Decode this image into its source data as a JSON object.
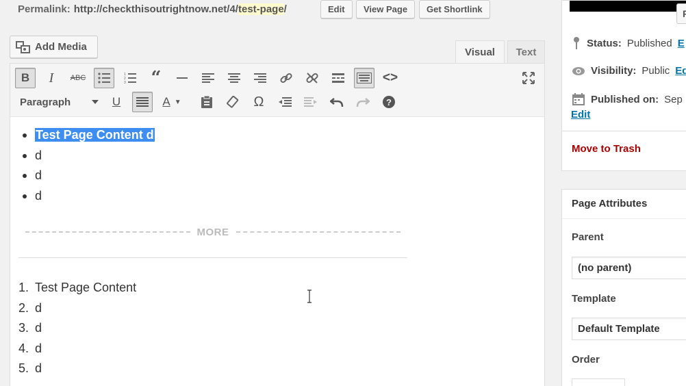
{
  "permalink": {
    "label": "Permalink:",
    "base_url": "http://checkthisoutrightnow.net/4/",
    "slug": "test-page",
    "trailing": "/",
    "edit_label": "Edit",
    "view_label": "View Page",
    "shortlink_label": "Get Shortlink"
  },
  "media": {
    "add_media_label": "Add Media"
  },
  "tabs": {
    "visual": "Visual",
    "text": "Text"
  },
  "toolbar": {
    "format_select": "Paragraph",
    "row1": [
      "bold-icon",
      "italic-icon",
      "strikethrough-icon",
      "bullet-list-icon",
      "numbered-list-icon",
      "blockquote-icon",
      "horizontal-rule-icon",
      "align-left-icon",
      "align-center-icon",
      "align-right-icon",
      "insert-link-icon",
      "remove-link-icon",
      "read-more-icon",
      "toolbar-toggle-icon",
      "code-icon"
    ],
    "row2": [
      "underline-icon",
      "justify-icon",
      "text-color-icon",
      "paste-text-icon",
      "clear-formatting-icon",
      "special-character-icon",
      "outdent-icon",
      "indent-icon",
      "undo-icon",
      "redo-icon",
      "help-icon"
    ]
  },
  "editor": {
    "bullets": [
      "Test Page Content d",
      "d",
      "d",
      "d"
    ],
    "more_label": "MORE",
    "numbered": [
      {
        "n": "1.",
        "text": "Test Page Content"
      },
      {
        "n": "2.",
        "text": "d"
      },
      {
        "n": "3.",
        "text": "d"
      },
      {
        "n": "4.",
        "text": "d"
      },
      {
        "n": "5.",
        "text": "d"
      }
    ]
  },
  "publish": {
    "top_button": "P",
    "status_label": "Status:",
    "status_value": "Published",
    "status_link": "E",
    "visibility_label": "Visibility:",
    "visibility_value": "Public",
    "visibility_link": "Ed",
    "published_label": "Published on:",
    "published_value": "Sep",
    "published_link": "Edit",
    "trash_label": "Move to Trash"
  },
  "attributes": {
    "title": "Page Attributes",
    "parent_label": "Parent",
    "parent_value": "(no parent)",
    "template_label": "Template",
    "template_value": "Default Template",
    "order_label": "Order"
  },
  "colors": {
    "accent": "#0073aa",
    "selection": "#3d8ef0",
    "trash": "#aa0000",
    "slug_highlight": "#fffbcc"
  }
}
